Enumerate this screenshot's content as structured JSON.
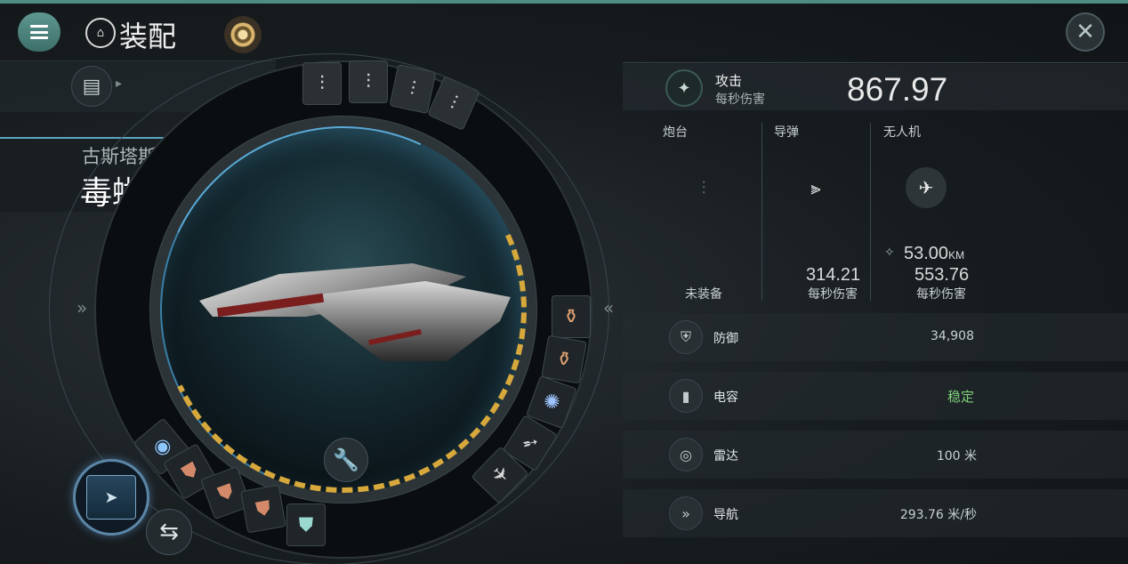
{
  "header": {
    "title": "装配",
    "title_icon": "station-icon",
    "close_glyph": "✕",
    "menu_icon": "hamburger-menu-icon"
  },
  "ship": {
    "faction": "古斯塔斯",
    "name": "毒蜥级",
    "name_arrow": "»"
  },
  "navigation": {
    "left_chevron": "»",
    "right_chevron": "«"
  },
  "attack": {
    "label": "攻击",
    "sublabel": "每秒伤害",
    "total_dps": "867.97",
    "columns": [
      {
        "label": "炮台",
        "status": "未装备"
      },
      {
        "label": "导弹",
        "dps": "314.21",
        "dps_label": "每秒伤害"
      },
      {
        "label": "无人机",
        "range": "53.00",
        "range_unit": "KM",
        "dps": "553.76",
        "dps_label": "每秒伤害"
      }
    ]
  },
  "stats": [
    {
      "label": "防御",
      "value": "34,908",
      "icon": "shield-icon"
    },
    {
      "label": "电容",
      "value": "稳定",
      "icon": "capacitor-icon"
    },
    {
      "label": "雷达",
      "value": "100 米",
      "icon": "radar-icon"
    },
    {
      "label": "导航",
      "value": "293.76 米/秒",
      "icon": "navigation-icon"
    }
  ],
  "colors": {
    "accent": "#4f8c83",
    "stable_green": "#7ed07a",
    "progress_gold": "#d7a83c",
    "scan_blue": "#5aa9d6"
  }
}
